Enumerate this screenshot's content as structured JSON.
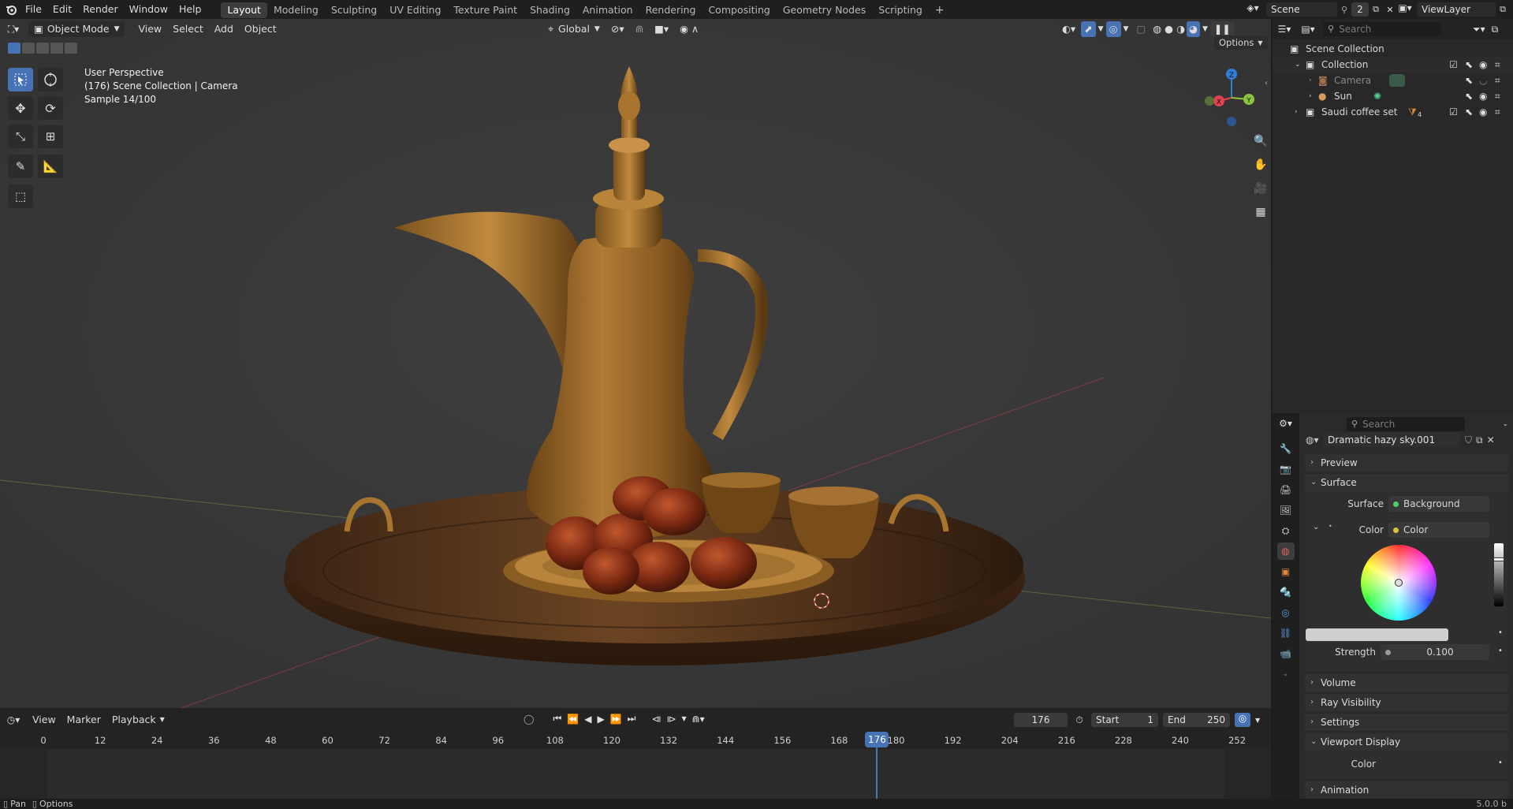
{
  "topbar": {
    "menus": [
      "File",
      "Edit",
      "Render",
      "Window",
      "Help"
    ],
    "workspaces": [
      "Layout",
      "Modeling",
      "Sculpting",
      "UV Editing",
      "Texture Paint",
      "Shading",
      "Animation",
      "Rendering",
      "Compositing",
      "Geometry Nodes",
      "Scripting"
    ],
    "active_workspace": "Layout",
    "scene_name": "Scene",
    "scene_count": "2",
    "view_layer": "ViewLayer"
  },
  "viewport": {
    "mode": "Object Mode",
    "menus": [
      "View",
      "Select",
      "Add",
      "Object"
    ],
    "transform_orientation": "Global",
    "options_label": "Options",
    "overlay_title": "User Perspective",
    "overlay_collection": "(176) Scene Collection | Camera",
    "overlay_sample": "Sample 14/100",
    "gizmo": {
      "z": "Z",
      "x": "X",
      "y": "Y"
    }
  },
  "timeline": {
    "menus": [
      "View",
      "Marker",
      "Playback"
    ],
    "current_frame": "176",
    "start_label": "Start",
    "start": "1",
    "end_label": "End",
    "end": "250",
    "ticks": [
      "0",
      "12",
      "24",
      "36",
      "48",
      "60",
      "72",
      "84",
      "96",
      "108",
      "120",
      "132",
      "144",
      "156",
      "168",
      "180",
      "192",
      "204",
      "216",
      "228",
      "240",
      "252"
    ],
    "playhead_label": "176"
  },
  "statusbar": {
    "left_1": "Pan",
    "left_2": "Options",
    "version": "5.0.0 b"
  },
  "outliner": {
    "search_placeholder": "Search",
    "scene_collection": "Scene Collection",
    "items": [
      {
        "name": "Collection"
      },
      {
        "name": "Camera"
      },
      {
        "name": "Sun"
      },
      {
        "name": "Saudi coffee set",
        "badge": "4"
      }
    ]
  },
  "properties": {
    "search_placeholder": "Search",
    "world_name": "Dramatic hazy sky.001",
    "panels": {
      "preview": "Preview",
      "surface": "Surface",
      "volume": "Volume",
      "ray_visibility": "Ray Visibility",
      "settings": "Settings",
      "viewport_display": "Viewport Display",
      "animation": "Animation"
    },
    "surface_label": "Surface",
    "surface_value": "Background",
    "color_label": "Color",
    "color_value": "Color",
    "strength_label": "Strength",
    "strength_value": "0.100",
    "vd_color_label": "Color"
  },
  "colors": {
    "accent": "#4772b3",
    "x_axis": "#e2434f",
    "y_axis": "#8bc53f",
    "z_axis": "#2f7fd8"
  }
}
